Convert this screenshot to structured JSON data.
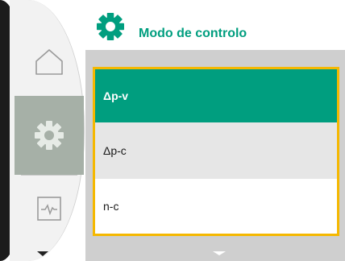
{
  "header": {
    "title": "Modo de controlo",
    "icon": "gear-icon",
    "title_color": "#009e7f"
  },
  "sidebar": {
    "items": [
      {
        "icon": "home-icon",
        "selected": false
      },
      {
        "icon": "gear-icon",
        "selected": true
      },
      {
        "icon": "diagnostics-icon",
        "selected": false
      }
    ]
  },
  "menu": {
    "items": [
      {
        "label": "Δp-v",
        "selected": true
      },
      {
        "label": "Δp-c",
        "selected": false
      },
      {
        "label": "n-c",
        "selected": false
      }
    ]
  },
  "colors": {
    "accent": "#009e7f",
    "focus_border": "#f5b800",
    "sidebar_selected": "#a6b0a7"
  }
}
